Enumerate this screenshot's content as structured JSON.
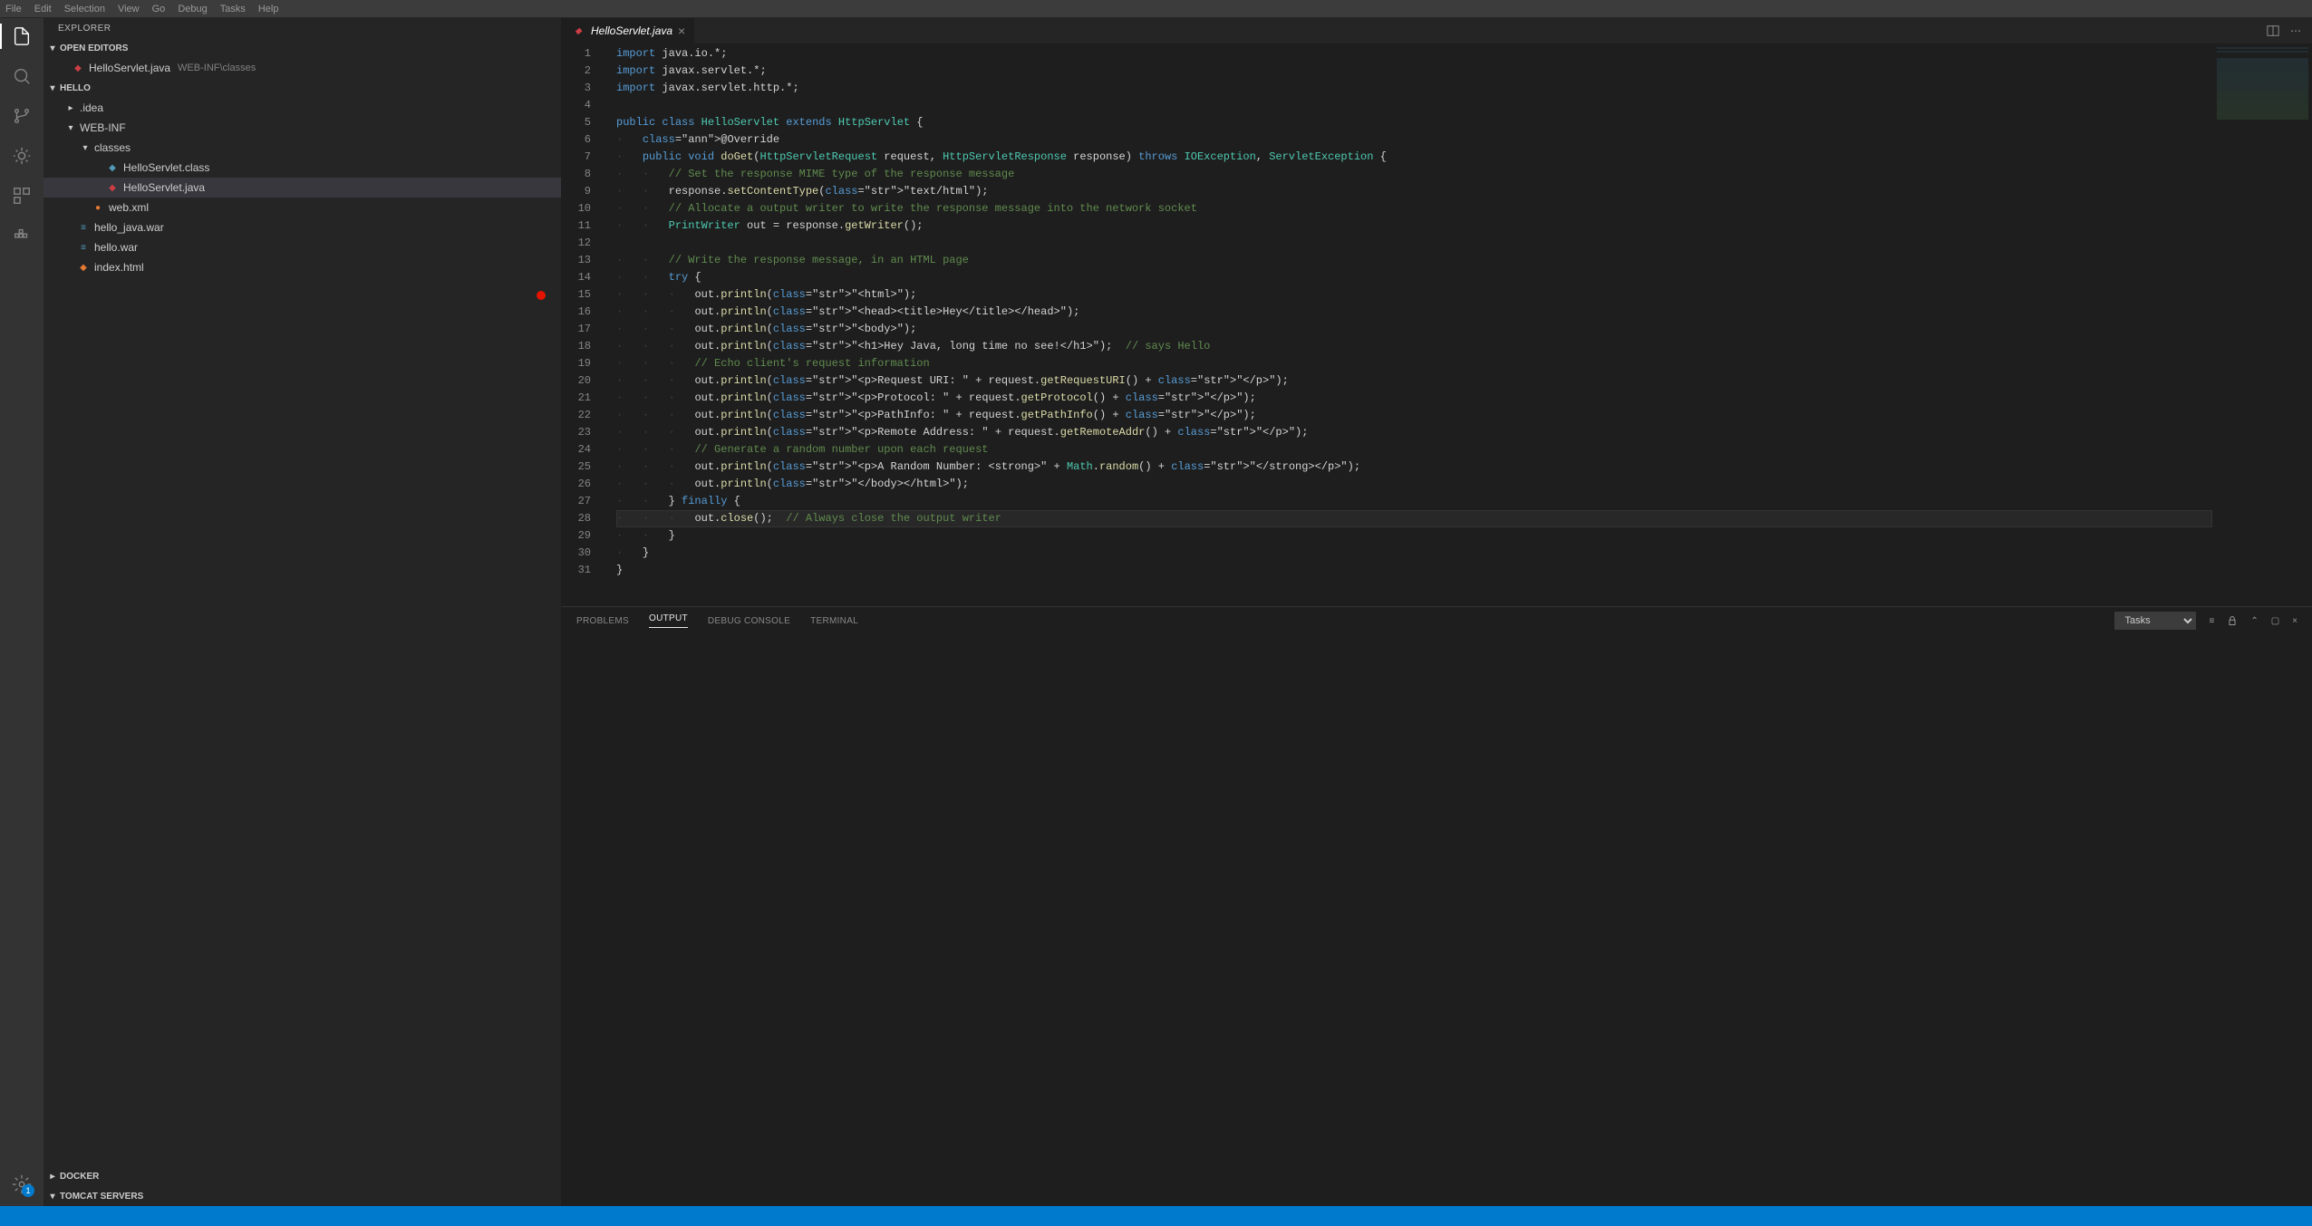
{
  "menu": [
    "File",
    "Edit",
    "Selection",
    "View",
    "Go",
    "Debug",
    "Tasks",
    "Help"
  ],
  "activity": {
    "badge": "1"
  },
  "sidebar": {
    "title": "EXPLORER",
    "open_editors_label": "OPEN EDITORS",
    "open_editors": [
      {
        "name": "HelloServlet.java",
        "desc": "WEB-INF\\classes"
      }
    ],
    "project_label": "HELLO",
    "tree": {
      "idea": ".idea",
      "webinf": "WEB-INF",
      "classes": "classes",
      "hello_servlet_class": "HelloServlet.class",
      "hello_servlet_java": "HelloServlet.java",
      "web_xml": "web.xml",
      "hello_java_war": "hello_java.war",
      "hello_war": "hello.war",
      "index_html": "index.html"
    },
    "docker_label": "DOCKER",
    "tomcat_label": "TOMCAT SERVERS"
  },
  "tab": {
    "name": "HelloServlet.java"
  },
  "code": {
    "lines": [
      "import java.io.*;",
      "import javax.servlet.*;",
      "import javax.servlet.http.*;",
      "",
      "public class HelloServlet extends HttpServlet {",
      "    @Override",
      "    public void doGet(HttpServletRequest request, HttpServletResponse response) throws IOException, ServletException {",
      "        // Set the response MIME type of the response message",
      "        response.setContentType(\"text/html\");",
      "        // Allocate a output writer to write the response message into the network socket",
      "        PrintWriter out = response.getWriter();",
      "",
      "        // Write the response message, in an HTML page",
      "        try {",
      "            out.println(\"<html>\");",
      "            out.println(\"<head><title>Hey</title></head>\");",
      "            out.println(\"<body>\");",
      "            out.println(\"<h1>Hey Java, long time no see!</h1>\");  // says Hello",
      "            // Echo client's request information",
      "            out.println(\"<p>Request URI: \" + request.getRequestURI() + \"</p>\");",
      "            out.println(\"<p>Protocol: \" + request.getProtocol() + \"</p>\");",
      "            out.println(\"<p>PathInfo: \" + request.getPathInfo() + \"</p>\");",
      "            out.println(\"<p>Remote Address: \" + request.getRemoteAddr() + \"</p>\");",
      "            // Generate a random number upon each request",
      "            out.println(\"<p>A Random Number: <strong>\" + Math.random() + \"</strong></p>\");",
      "            out.println(\"</body></html>\");",
      "        } finally {",
      "            out.close();  // Always close the output writer",
      "        }",
      "    }",
      "}"
    ],
    "breakpoint_line": 15,
    "current_line": 28
  },
  "panel": {
    "tabs": {
      "problems": "PROBLEMS",
      "output": "OUTPUT",
      "debug_console": "DEBUG CONSOLE",
      "terminal": "TERMINAL"
    },
    "select_value": "Tasks"
  },
  "status": {
    "left": ""
  }
}
